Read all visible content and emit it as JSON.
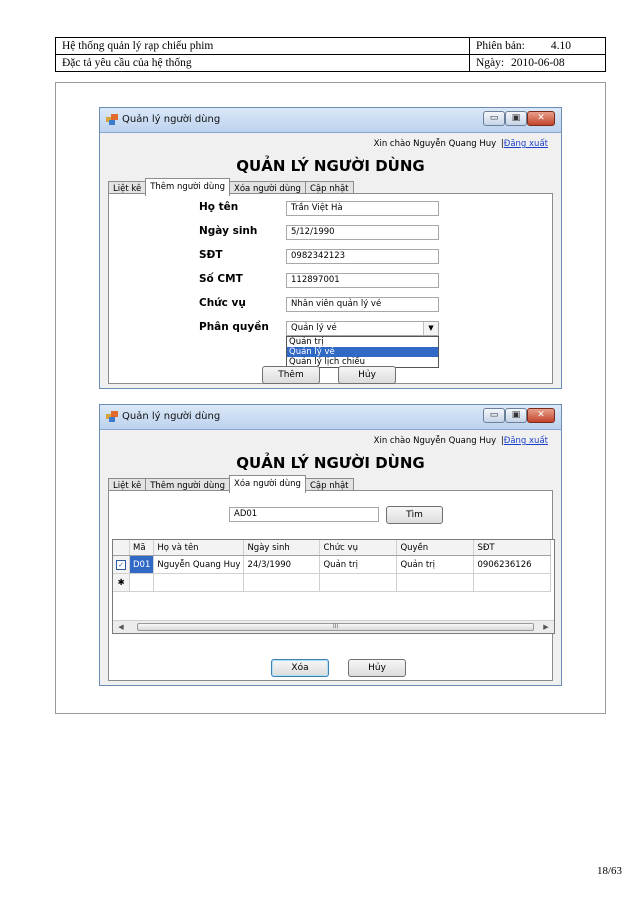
{
  "header": {
    "system_name": "Hệ thống quản lý rạp chiếu phim",
    "version_label": "Phiên bản:",
    "version_value": "4.10",
    "spec_title": "Đặc tả yêu cầu của hệ thống",
    "date_label": "Ngày:",
    "date_value": "2010-06-08"
  },
  "window1": {
    "title": "Quản lý người dùng",
    "greeting": "Xin chào Nguyễn Quang Huy",
    "logout": "Đăng xuất",
    "heading": "QUẢN LÝ NGƯỜI DÙNG",
    "tabs": [
      "Liệt kê",
      "Thêm người dùng",
      "Xóa người dùng",
      "Cập nhật"
    ],
    "form": {
      "fullname_label": "Họ tên",
      "fullname_value": "Trần Việt Hà",
      "dob_label": "Ngày sinh",
      "dob_value": "5/12/1990",
      "phone_label": "SĐT",
      "phone_value": "0982342123",
      "id_label": "Số CMT",
      "id_value": "112897001",
      "position_label": "Chức vụ",
      "position_value": "Nhân viên quản lý vé",
      "role_label": "Phân quyền",
      "role_value": "Quản lý vé",
      "role_options": [
        "Quản trị",
        "Quản lý vé",
        "Quản lý lịch chiếu"
      ]
    },
    "add_button": "Thêm",
    "cancel_button": "Hủy"
  },
  "window2": {
    "title": "Quản lý người dùng",
    "greeting": "Xin chào Nguyễn Quang Huy",
    "logout": "Đăng xuất",
    "heading": "QUẢN LÝ NGƯỜI DÙNG",
    "tabs": [
      "Liệt kê",
      "Thêm người dùng",
      "Xóa người dùng",
      "Cập nhật"
    ],
    "search_value": "AD01",
    "search_button": "Tìm",
    "grid": {
      "columns": [
        "Mã",
        "Họ và tên",
        "Ngày sinh",
        "Chức vụ",
        "Quyền",
        "SĐT"
      ],
      "rows": [
        [
          "D01",
          "Nguyễn Quang Huy",
          "24/3/1990",
          "Quản trị",
          "Quản trị",
          "0906236126"
        ]
      ],
      "new_row_marker": "✱",
      "scroll_grip": "III"
    },
    "delete_button": "Xóa",
    "cancel_button": "Hủy"
  },
  "footer": {
    "page": "18/63"
  }
}
